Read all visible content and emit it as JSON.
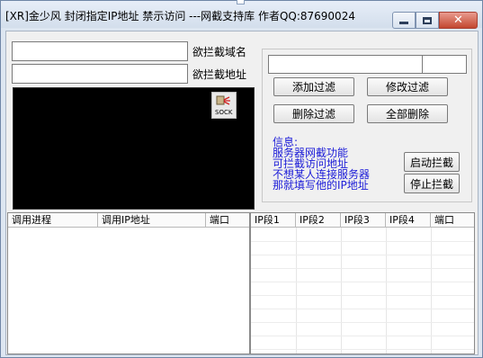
{
  "window": {
    "title": "[XR]金少风 封闭指定IP地址 禁示访问 ---网截支持库 作者QQ:87690024"
  },
  "inputs": {
    "domain_value": "",
    "ip_value": "",
    "filter_left_value": "",
    "filter_right_value": ""
  },
  "labels": {
    "domain": "欲拦截域名",
    "ip": "欲拦截地址"
  },
  "buttons": {
    "add_filter": "添加过滤",
    "modify_filter": "修改过滤",
    "delete_filter": "删除过滤",
    "delete_all": "全部删除",
    "start_intercept": "启动拦截",
    "stop_intercept": "停止拦截"
  },
  "info": {
    "lines": [
      "信息:",
      "服务器网截功能",
      "可拦截访问地址",
      "不想某人连接服务器",
      "那就填写他的IP地址"
    ]
  },
  "icons": {
    "sock": "sock-icon"
  },
  "left_table": {
    "columns": [
      "调用进程",
      "调用IP地址",
      "端口"
    ]
  },
  "right_table": {
    "columns": [
      "IP段1",
      "IP段2",
      "IP段3",
      "IP段4",
      "端口"
    ]
  }
}
